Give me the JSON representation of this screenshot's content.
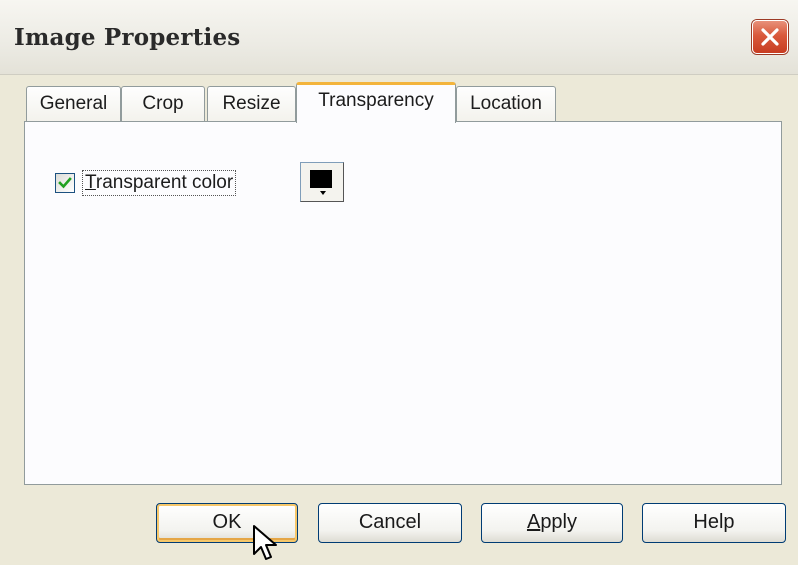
{
  "window": {
    "title": "Image Properties",
    "close_icon": "close-x-icon"
  },
  "tabs": [
    {
      "label": "General",
      "active": false
    },
    {
      "label": "Crop",
      "active": false
    },
    {
      "label": "Resize",
      "active": false
    },
    {
      "label": "Transparency",
      "active": true
    },
    {
      "label": "Location",
      "active": false
    }
  ],
  "transparency": {
    "checkbox_label": "Transparent color",
    "checked": true,
    "color_value": "#000000"
  },
  "buttons": {
    "ok": "OK",
    "cancel": "Cancel",
    "apply_mnemonic": "A",
    "apply_rest": "pply",
    "help": "Help"
  },
  "colors": {
    "accent_tab": "#f3b43c",
    "close_button": "#d9593c",
    "check_mark": "#21a121"
  }
}
